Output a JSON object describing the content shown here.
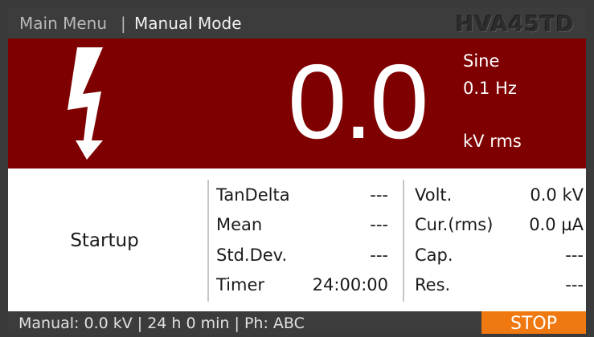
{
  "header": {
    "main_menu": "Main Menu",
    "separator": "|",
    "current_mode": "Manual Mode",
    "model": "HVA45TD"
  },
  "voltage_panel": {
    "icon": "high-voltage-bolt-icon",
    "value": "0.0",
    "waveform": "Sine",
    "frequency": "0.1 Hz",
    "unit": "kV rms",
    "background_color": "#7f0000"
  },
  "measurements": {
    "status": "Startup",
    "middle": [
      {
        "label": "TanDelta",
        "value": "---"
      },
      {
        "label": "Mean",
        "value": "---"
      },
      {
        "label": "Std.Dev.",
        "value": "---"
      },
      {
        "label": "Timer",
        "value": "24:00:00"
      }
    ],
    "right": [
      {
        "label": "Volt.",
        "value": "0.0 kV"
      },
      {
        "label": "Cur.(rms)",
        "value": "0.0 µA"
      },
      {
        "label": "Cap.",
        "value": "---"
      },
      {
        "label": "Res.",
        "value": "---"
      }
    ]
  },
  "footer": {
    "status_text": "Manual: 0.0 kV | 24 h 0 min | Ph: ABC",
    "stop_label": "STOP",
    "stop_color": "#f07810"
  }
}
